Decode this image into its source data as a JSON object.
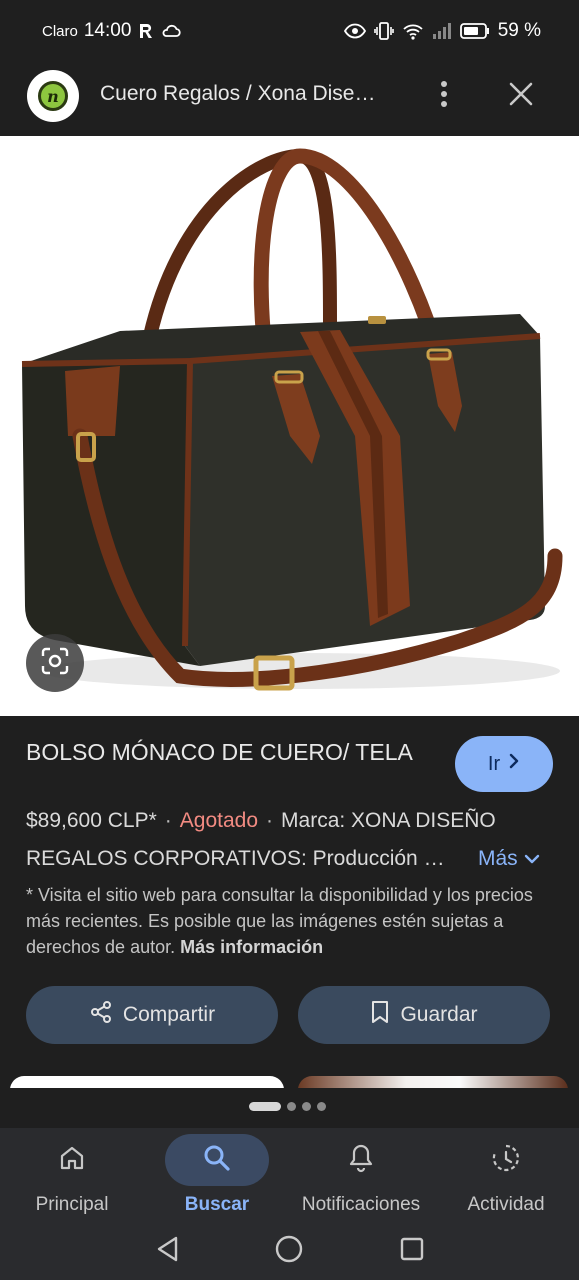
{
  "status_bar": {
    "carrier": "Claro",
    "time": "14:00",
    "battery": "59 %"
  },
  "header": {
    "title": "Cuero Regalos / Xona Dise…",
    "logo_letter": "n"
  },
  "product": {
    "title": "BOLSO MÓNACO DE CUERO/ TELA",
    "go_label": "Ir",
    "price": "$89,600 CLP*",
    "separator": "·",
    "stock_status": "Agotado",
    "brand": "Marca: XONA DISEÑO",
    "description": "REGALOS CORPORATIVOS: Producción …",
    "more_label": "Más",
    "disclaimer": "* Visita el sitio web para consultar la disponibilidad y los precios más recientes. Es posible que las imágenes estén sujetas a derechos de autor.",
    "disclaimer_link": "Más información"
  },
  "actions": {
    "share_label": "Compartir",
    "save_label": "Guardar"
  },
  "bottom_nav": {
    "items": [
      {
        "label": "Principal",
        "icon": "home-icon",
        "active": false
      },
      {
        "label": "Buscar",
        "icon": "search-icon",
        "active": true
      },
      {
        "label": "Notificaciones",
        "icon": "bell-icon",
        "active": false
      },
      {
        "label": "Actividad",
        "icon": "activity-icon",
        "active": false
      }
    ]
  },
  "colors": {
    "background": "#1f1f1f",
    "accent": "#8ab4f8",
    "stock_out": "#f28b82",
    "action_button": "#3a4a5e",
    "nav_active_pill": "#3b4a63"
  }
}
